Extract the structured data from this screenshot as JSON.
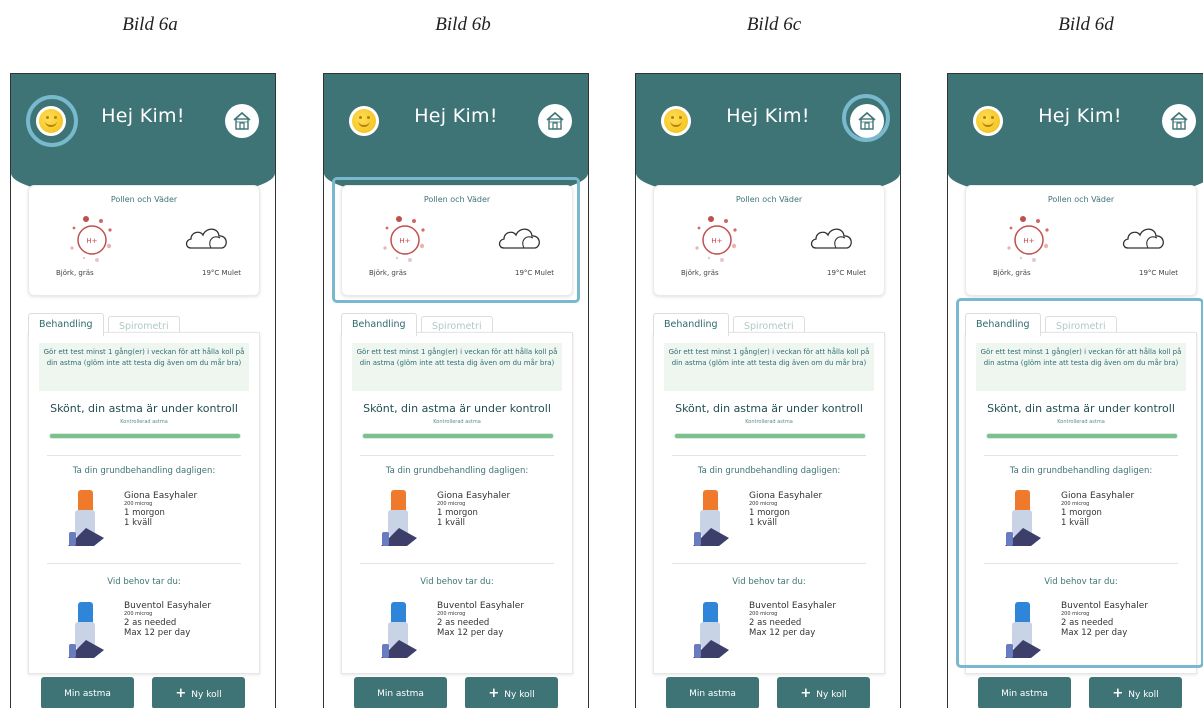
{
  "captions": [
    "Bild 6a",
    "Bild 6b",
    "Bild 6c",
    "Bild 6d"
  ],
  "app": {
    "greeting": "Hej Kim!",
    "weather": {
      "title": "Pollen och Väder",
      "pollen_level": "H+",
      "pollen_label": "Björk, gräs",
      "weather_label": "19°C Mulet"
    },
    "tabs": [
      "Behandling",
      "Spirometri"
    ],
    "notice": "Gör ett test minst 1 gång(er) i veckan för att hålla koll på din astma (glöm inte att testa dig även om du mår bra)",
    "status": "Skönt, din astma är under kontroll",
    "status_sub": "Kontrollerad astma",
    "control_level": 1.0,
    "daily_title": "Ta din grundbehandling dagligen:",
    "daily_med": {
      "name": "Giona Easyhaler",
      "dose": "200 microg",
      "line1": "1 morgon",
      "line2": "1 kväll"
    },
    "asneeded_title": "Vid behov tar du:",
    "asneeded_med": {
      "name": "Buventol Easyhaler",
      "dose": "200 microg",
      "line1": "2 as needed",
      "line2": "Max 12 per day"
    },
    "button_min": "Min astma",
    "button_ny": "Ny koll"
  },
  "colors": {
    "header": "#3f7476",
    "highlight": "#78b9ce",
    "bar": "#7cc08e",
    "notice_bg": "#eef6ef",
    "inhaler_daily": "#f07a2c",
    "inhaler_asneeded": "#2f86d8"
  },
  "highlights": [
    "smiley-button",
    "weather-card",
    "home-button",
    "treatment-card"
  ]
}
